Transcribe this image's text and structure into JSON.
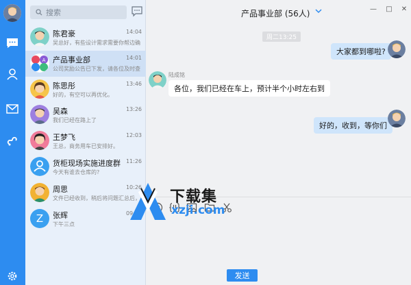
{
  "rail": {
    "items": [
      "user-avatar",
      "chat-icon",
      "contacts-icon",
      "mail-icon",
      "link-icon",
      "settings-icon"
    ]
  },
  "search": {
    "placeholder": "搜索"
  },
  "conversations": [
    {
      "name": "陈君豪",
      "time": "14:04",
      "preview": "吴总好，有些设计需求需要你帮边确"
    },
    {
      "name": "产品事业部",
      "time": "14:01",
      "preview": "公司奖励公告已下发，请各位及时查"
    },
    {
      "name": "陈思彤",
      "time": "13:46",
      "preview": "好的，有空可以再优化。"
    },
    {
      "name": "吴森",
      "time": "13:26",
      "preview": "我们已经在路上了"
    },
    {
      "name": "王梦飞",
      "time": "12:03",
      "preview": "王总，商务用车已安排好。"
    },
    {
      "name": "货柜现场实施进度群",
      "time": "11:26",
      "preview": "今天有谁去仓库的?"
    },
    {
      "name": "周思",
      "time": "10:26",
      "preview": "文件已经收到，稍后将问题汇总后，"
    },
    {
      "name": "张辉",
      "time": "09:26",
      "preview": "下午三点"
    }
  ],
  "chat": {
    "title": "产品事业部 (56人)",
    "timestamp": "周二13:25",
    "messages": [
      {
        "side": "right",
        "text": "大家都到哪啦?"
      },
      {
        "side": "left",
        "sender": "陆成铭",
        "text": "各位，我们已经在车上，预计半个小时左右到"
      },
      {
        "side": "right",
        "text": "好的，收到，等你们"
      }
    ],
    "send_label": "发送"
  },
  "window": {
    "minimize": "—",
    "maximize": "□",
    "close": "✕"
  },
  "watermark": {
    "line1": "下载集",
    "line2": "xzji.com"
  },
  "colors": {
    "accent": "#2d8cf0",
    "list_bg": "#e8f0fa",
    "active_item": "#cfe0f5",
    "bubble_right": "#cfe5fb"
  }
}
